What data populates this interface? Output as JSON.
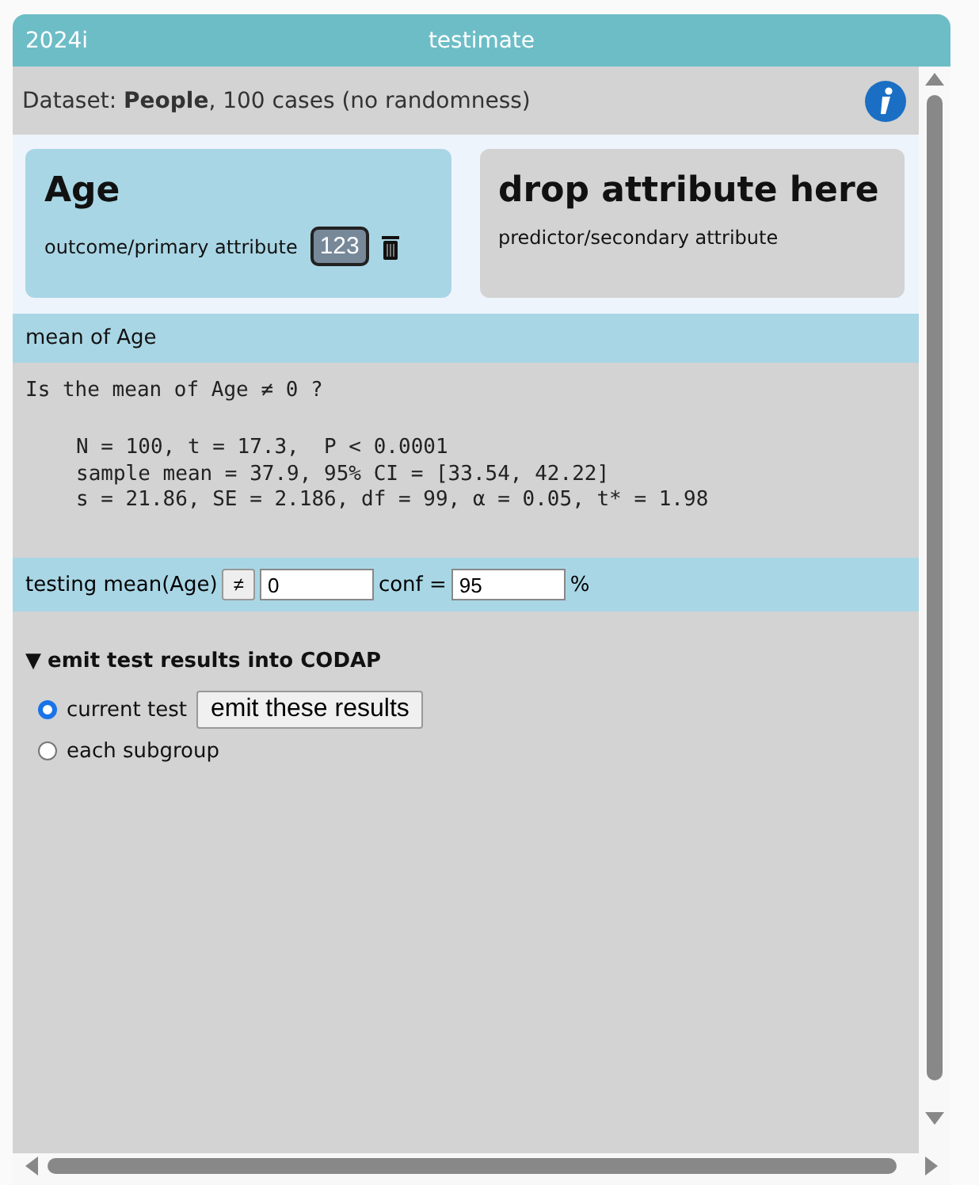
{
  "window": {
    "badge": "2024i",
    "title": "testimate"
  },
  "dataset": {
    "text": "Dataset: **People**, 100 cases (no randomness)"
  },
  "attributes": [
    {
      "name": "Age",
      "role": "outcome/primary attribute",
      "type_button": "123",
      "filled": true
    },
    {
      "name": "drop attribute here",
      "role": "predictor/secondary attribute",
      "filled": false
    }
  ],
  "test_title": "mean of Age",
  "results": {
    "question": "Is the mean of Age ≠ 0 ?",
    "lines": [
      "N = 100, t = 17.3,  P < 0.0001",
      "sample mean = 37.9, 95% CI = [33.54, 42.22]",
      "s = 21.86, SE = 2.186, df = 99, α = 0.05, t* = 1.98"
    ]
  },
  "config": {
    "label": "testing mean(Age)",
    "operator": "≠",
    "value": "0",
    "conf_label": "conf =",
    "conf_value": "95",
    "percent": "%"
  },
  "emit": {
    "toggle": "▼",
    "title": "emit test results into CODAP",
    "expanded": true,
    "options": [
      {
        "label": "current test",
        "selected": true,
        "button": "emit these results"
      },
      {
        "label": "each subgroup",
        "selected": false
      }
    ]
  }
}
